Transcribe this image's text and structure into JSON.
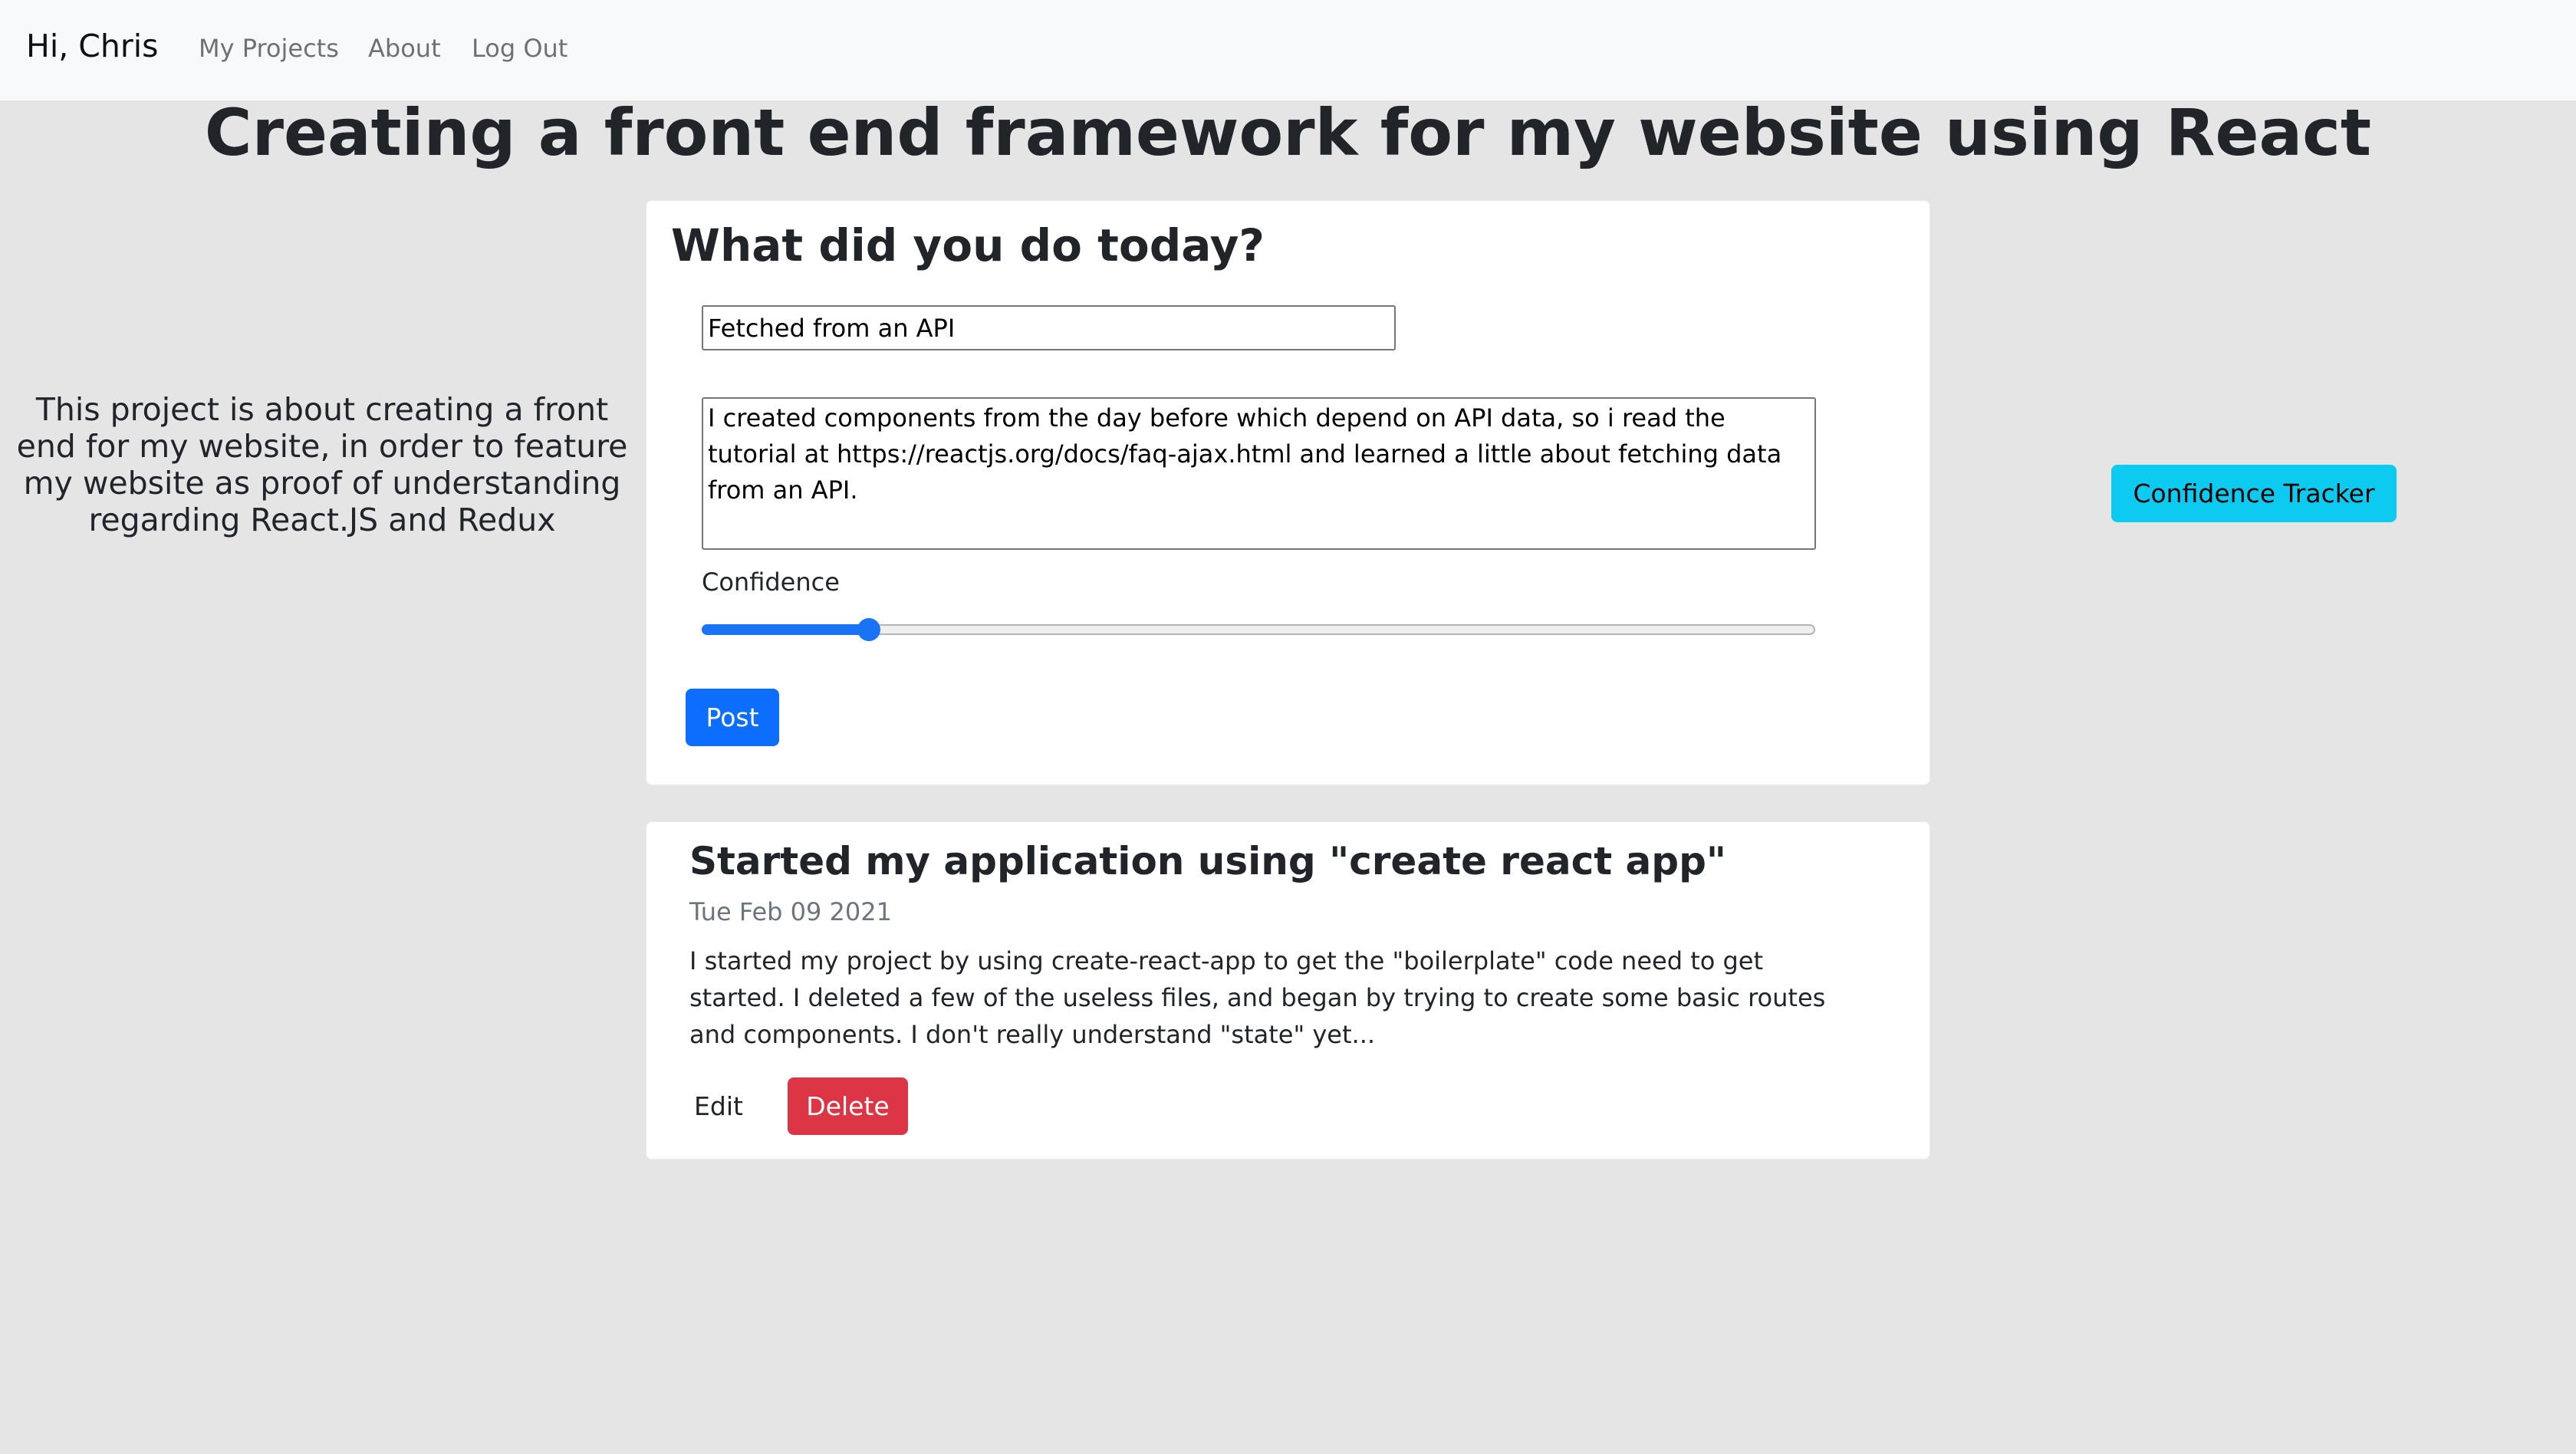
{
  "nav": {
    "greeting": "Hi, Chris",
    "links": [
      "My Projects",
      "About",
      "Log Out"
    ]
  },
  "page_title": "Creating a front end framework for my website using React",
  "description": "This project is about creating a front end for my website, in order to feature my website as proof of understanding regarding React.JS and Redux",
  "form": {
    "heading": "What did you do today?",
    "title_value": "Fetched from an API",
    "body_value": "I created components from the day before which depend on API data, so i read the tutorial at https://reactjs.org/docs/faq-ajax.html and learned a little about fetching data from an API.",
    "confidence_label": "Confidence",
    "confidence_value": 15,
    "post_label": "Post"
  },
  "posts": [
    {
      "title": "Started my application using \"create react app\"",
      "date": "Tue Feb 09 2021",
      "body": "I started my project by using create-react-app to get the \"boilerplate\" code need to get started. I deleted a few of the useless files, and began by trying to create some basic routes and components. I don't really understand \"state\" yet...",
      "edit_label": "Edit",
      "delete_label": "Delete"
    }
  ],
  "tracker_label": "Confidence Tracker",
  "colors": {
    "primary": "#0d6efd",
    "danger": "#dc3545",
    "info": "#0dcaf0",
    "background": "#e5e5e5"
  }
}
